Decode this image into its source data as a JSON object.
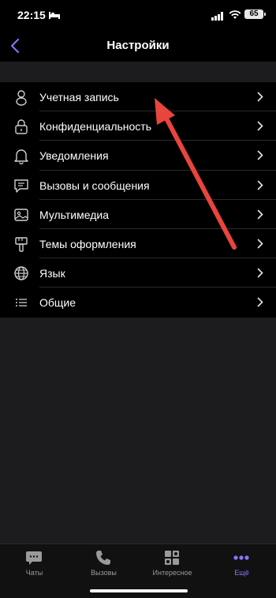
{
  "status_bar": {
    "time": "22:15",
    "battery": "65"
  },
  "nav": {
    "title": "Настройки"
  },
  "settings": [
    {
      "label": "Учетная запись",
      "icon": "person-icon"
    },
    {
      "label": "Конфиденциальность",
      "icon": "lock-icon"
    },
    {
      "label": "Уведомления",
      "icon": "bell-icon"
    },
    {
      "label": "Вызовы и сообщения",
      "icon": "chat-bubble-icon"
    },
    {
      "label": "Мультимедиа",
      "icon": "image-icon"
    },
    {
      "label": "Темы оформления",
      "icon": "paintbrush-icon"
    },
    {
      "label": "Язык",
      "icon": "globe-icon"
    },
    {
      "label": "Общие",
      "icon": "list-icon"
    }
  ],
  "tabs": [
    {
      "label": "Чаты",
      "icon": "chat-icon",
      "active": false
    },
    {
      "label": "Вызовы",
      "icon": "phone-icon",
      "active": false
    },
    {
      "label": "Интересное",
      "icon": "explore-icon",
      "active": false
    },
    {
      "label": "Ещё",
      "icon": "more-dots-icon",
      "active": true
    }
  ],
  "colors": {
    "accent": "#8e73ff",
    "annotation_arrow": "#e8453c"
  }
}
